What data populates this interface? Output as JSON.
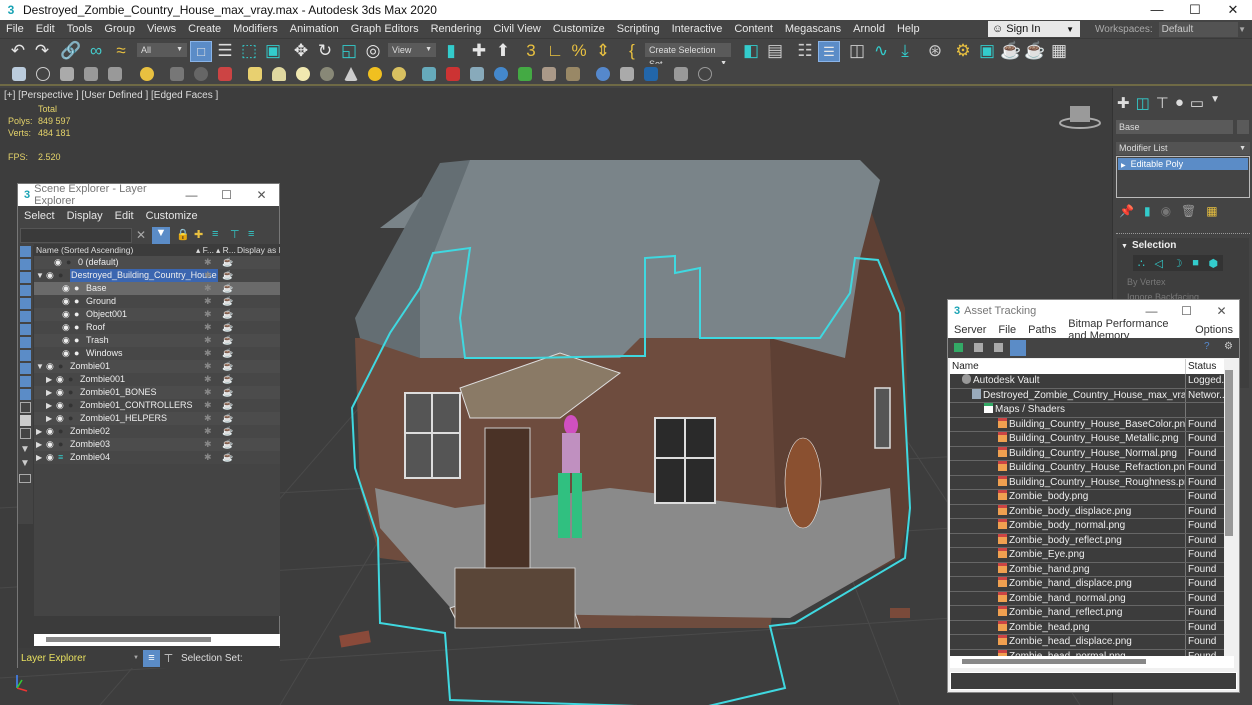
{
  "window": {
    "title": "Destroyed_Zombie_Country_House_max_vray.max - Autodesk 3ds Max 2020",
    "controls": [
      "minimize-icon",
      "maximize-icon",
      "close-icon"
    ]
  },
  "menu": {
    "items": [
      "File",
      "Edit",
      "Tools",
      "Group",
      "Views",
      "Create",
      "Modifiers",
      "Animation",
      "Graph Editors",
      "Rendering",
      "Civil View",
      "Customize",
      "Scripting",
      "Interactive",
      "Content",
      "Megascans",
      "Arnold",
      "Help"
    ],
    "sign_in": "Sign In",
    "workspaces_label": "Workspaces:",
    "workspaces_value": "Default"
  },
  "toolbar": {
    "selection_filter": "All",
    "ref_coord": "View",
    "selection_set": "Create Selection Set",
    "icons": [
      "undo-icon",
      "redo-icon",
      "link-icon",
      "unlink-icon",
      "bind-space-warp-icon",
      "select-object-icon",
      "select-by-name-icon",
      "rect-region-icon",
      "window-crossing-icon",
      "move-icon",
      "rotate-icon",
      "scale-icon",
      "placement-icon",
      "pivot-icon",
      "keyboard-shortcut-icon",
      "snaps-icon",
      "angle-snap-icon",
      "percent-snap-icon",
      "spinner-snap-icon",
      "named-selection-icon",
      "mirror-icon",
      "align-icon",
      "scene-explorer-icon",
      "layer-explorer-icon",
      "toggle-ribbon-icon",
      "curve-editor-icon",
      "schematic-view-icon",
      "material-editor-icon",
      "render-setup-icon",
      "render-frame-icon",
      "render-icon",
      "render-iterative-icon"
    ]
  },
  "viewport": {
    "label": "[+] [Perspective ] [User Defined ] [Edged Faces ]",
    "stats": {
      "total_label": "Total",
      "polys_label": "Polys:",
      "polys": "849 597",
      "verts_label": "Verts:",
      "verts": "484 181",
      "fps_label": "FPS:",
      "fps": "2.520"
    }
  },
  "scene_explorer": {
    "title": "Scene Explorer - Layer Explorer",
    "menu": [
      "Select",
      "Display",
      "Edit",
      "Customize"
    ],
    "columns": [
      "Name (Sorted Ascending)",
      "▴ F...",
      "▴ R...",
      "Display as E"
    ],
    "rows": [
      {
        "name": "0 (default)",
        "level": 1,
        "expander": "",
        "selected": false,
        "highlight": false
      },
      {
        "name": "Destroyed_Building_Country_House",
        "level": 0,
        "expander": "▼",
        "selected": true,
        "highlight": false
      },
      {
        "name": "Base",
        "level": 2,
        "expander": "",
        "selected": false,
        "highlight": true
      },
      {
        "name": "Ground",
        "level": 2,
        "expander": "",
        "selected": false,
        "highlight": false
      },
      {
        "name": "Object001",
        "level": 2,
        "expander": "",
        "selected": false,
        "highlight": false
      },
      {
        "name": "Roof",
        "level": 2,
        "expander": "",
        "selected": false,
        "highlight": false
      },
      {
        "name": "Trash",
        "level": 2,
        "expander": "",
        "selected": false,
        "highlight": false
      },
      {
        "name": "Windows",
        "level": 2,
        "expander": "",
        "selected": false,
        "highlight": false
      },
      {
        "name": "Zombie01",
        "level": 0,
        "expander": "▼",
        "selected": false,
        "highlight": false
      },
      {
        "name": "Zombie001",
        "level": 3,
        "expander": "▶",
        "selected": false,
        "highlight": false
      },
      {
        "name": "Zombie01_BONES",
        "level": 3,
        "expander": "▶",
        "selected": false,
        "highlight": false
      },
      {
        "name": "Zombie01_CONTROLLERS",
        "level": 3,
        "expander": "▶",
        "selected": false,
        "highlight": false
      },
      {
        "name": "Zombie01_HELPERS",
        "level": 3,
        "expander": "▶",
        "selected": false,
        "highlight": false
      },
      {
        "name": "Zombie02",
        "level": 0,
        "expander": "▶",
        "selected": false,
        "highlight": false
      },
      {
        "name": "Zombie03",
        "level": 0,
        "expander": "▶",
        "selected": false,
        "highlight": false
      },
      {
        "name": "Zombie04",
        "level": 0,
        "expander": "▶",
        "selected": false,
        "highlight": false
      }
    ],
    "footer_explorer": "Layer Explorer",
    "footer_selection_set": "Selection Set:"
  },
  "command_panel": {
    "tabs": [
      "create-icon",
      "modify-icon",
      "hierarchy-icon",
      "motion-icon",
      "display-icon",
      "utilities-icon"
    ],
    "object_name": "Base",
    "modifier_list": "Modifier List",
    "stack": [
      "Editable Poly"
    ],
    "rollout_title": "Selection",
    "options": [
      "By Vertex",
      "Ignore Backfacing"
    ]
  },
  "asset_tracking": {
    "title": "Asset Tracking",
    "menu": [
      "Server",
      "File",
      "Paths",
      "Bitmap Performance and Memory",
      "Options"
    ],
    "columns": [
      "Name",
      "Status"
    ],
    "rows": [
      {
        "name": "Autodesk Vault",
        "status": "Logged.",
        "indent": 1,
        "icon": "vault"
      },
      {
        "name": "Destroyed_Zombie_Country_House_max_vray.max",
        "status": "Networ...",
        "indent": 2,
        "icon": "max"
      },
      {
        "name": "Maps / Shaders",
        "status": "",
        "indent": 3,
        "icon": "folder"
      },
      {
        "name": "Building_Country_House_BaseColor.png",
        "status": "Found",
        "indent": 4,
        "icon": "png"
      },
      {
        "name": "Building_Country_House_Metallic.png",
        "status": "Found",
        "indent": 4,
        "icon": "png"
      },
      {
        "name": "Building_Country_House_Normal.png",
        "status": "Found",
        "indent": 4,
        "icon": "png"
      },
      {
        "name": "Building_Country_House_Refraction.png",
        "status": "Found",
        "indent": 4,
        "icon": "png"
      },
      {
        "name": "Building_Country_House_Roughness.png",
        "status": "Found",
        "indent": 4,
        "icon": "png"
      },
      {
        "name": "Zombie_body.png",
        "status": "Found",
        "indent": 4,
        "icon": "png"
      },
      {
        "name": "Zombie_body_displace.png",
        "status": "Found",
        "indent": 4,
        "icon": "png"
      },
      {
        "name": "Zombie_body_normal.png",
        "status": "Found",
        "indent": 4,
        "icon": "png"
      },
      {
        "name": "Zombie_body_reflect.png",
        "status": "Found",
        "indent": 4,
        "icon": "png"
      },
      {
        "name": "Zombie_Eye.png",
        "status": "Found",
        "indent": 4,
        "icon": "png"
      },
      {
        "name": "Zombie_hand.png",
        "status": "Found",
        "indent": 4,
        "icon": "png"
      },
      {
        "name": "Zombie_hand_displace.png",
        "status": "Found",
        "indent": 4,
        "icon": "png"
      },
      {
        "name": "Zombie_hand_normal.png",
        "status": "Found",
        "indent": 4,
        "icon": "png"
      },
      {
        "name": "Zombie_hand_reflect.png",
        "status": "Found",
        "indent": 4,
        "icon": "png"
      },
      {
        "name": "Zombie_head.png",
        "status": "Found",
        "indent": 4,
        "icon": "png"
      },
      {
        "name": "Zombie_head_displace.png",
        "status": "Found",
        "indent": 4,
        "icon": "png"
      },
      {
        "name": "Zombie_head_normal.png",
        "status": "Found",
        "indent": 4,
        "icon": "png"
      }
    ]
  },
  "colors": {
    "accent_blue": "#5b8cc7",
    "selection_highlight": "#4aa8f0",
    "stats_yellow": "#e4d36a",
    "selection_outline": "#3fd8e0"
  }
}
